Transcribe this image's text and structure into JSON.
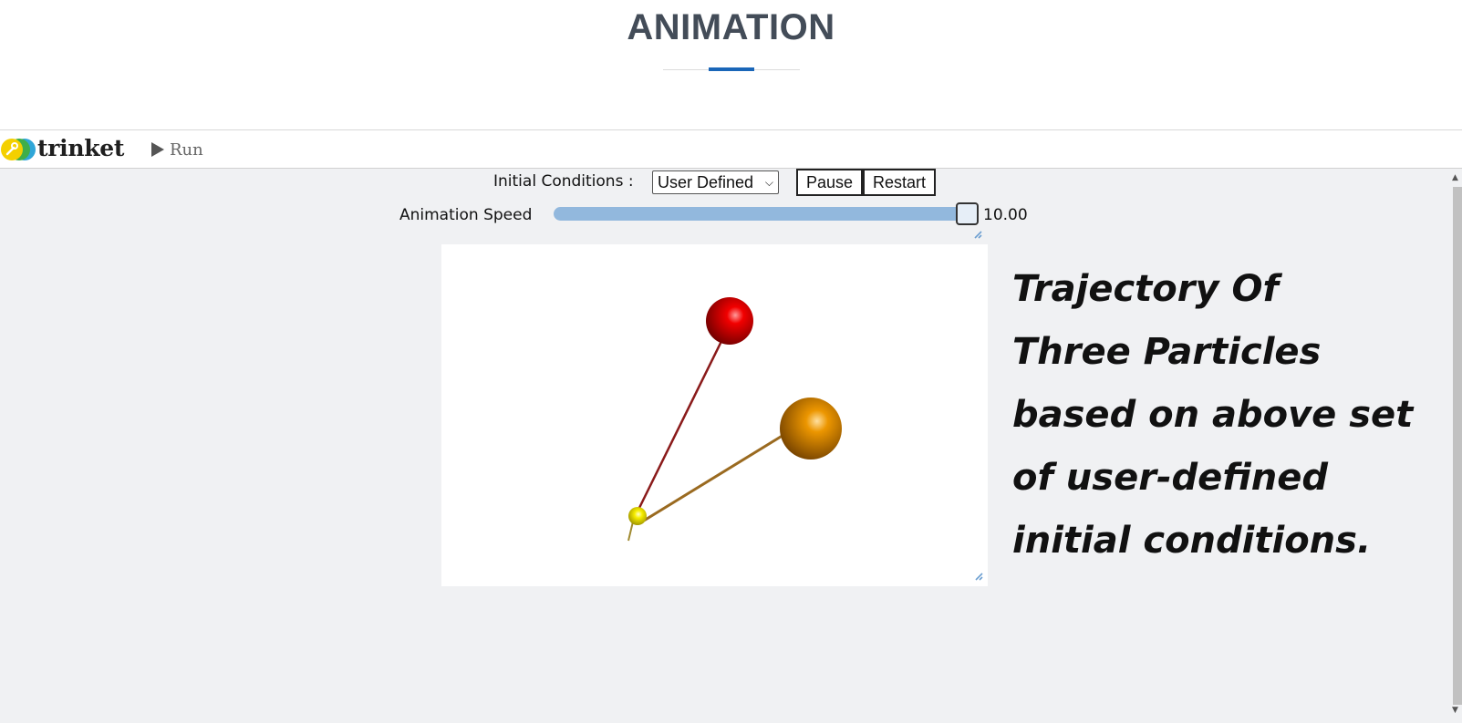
{
  "header": {
    "title": "ANIMATION"
  },
  "toolbar": {
    "brand": "trinket",
    "run_label": "Run"
  },
  "controls": {
    "initial_conditions_label": "Initial Conditions :",
    "initial_conditions_selected": "User Defined",
    "pause_label": "Pause",
    "restart_label": "Restart",
    "speed_label": "Animation Speed",
    "speed_value": "10.00",
    "speed_fraction": 1.0
  },
  "scene": {
    "particles": [
      {
        "name": "red-particle",
        "color": "#d80000"
      },
      {
        "name": "orange-particle",
        "color": "#e08a00"
      },
      {
        "name": "yellow-particle",
        "color": "#f2e600"
      }
    ]
  },
  "caption": {
    "lines": [
      "Trajectory Of",
      "Three Particles",
      "based on above set",
      "of user-defined",
      "initial conditions."
    ]
  }
}
